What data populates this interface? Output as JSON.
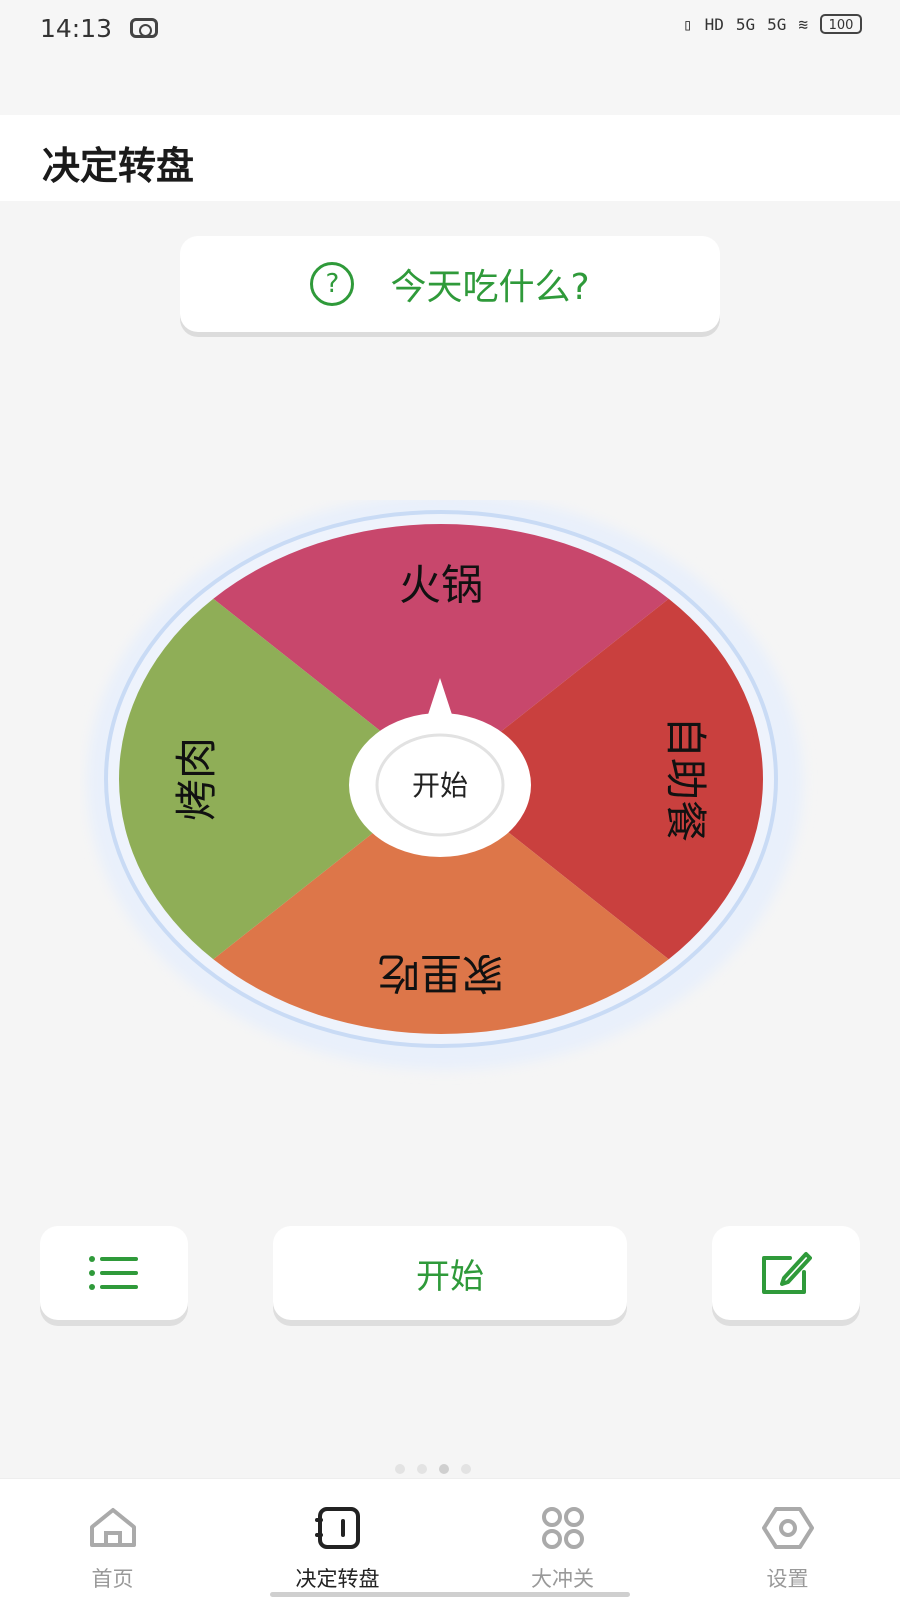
{
  "status_bar": {
    "time": "14:13",
    "icons": [
      "privacy-icon",
      "vibrate-icon",
      "hd-icon",
      "signal-5g-icon",
      "signal-5g-icon",
      "wifi-icon"
    ],
    "hd_label": "HD",
    "network_1": "5G",
    "network_2": "5G",
    "battery": "100"
  },
  "header": {
    "title": "决定转盘"
  },
  "question": {
    "text": "今天吃什么?",
    "icon": "question-circle-icon",
    "icon_glyph": "?"
  },
  "wheel": {
    "segments": [
      {
        "label": "火锅",
        "color": "#c8476c",
        "share": 0.25
      },
      {
        "label": "自助餐",
        "color": "#c9403e",
        "share": 0.25
      },
      {
        "label": "家里吃",
        "color": "#dd7649",
        "share": 0.25
      },
      {
        "label": "烤肉",
        "color": "#8fae57",
        "share": 0.25
      }
    ],
    "center_label": "开始",
    "pointer": "up"
  },
  "actions": {
    "list_icon": "list-icon",
    "start_label": "开始",
    "edit_icon": "edit-icon"
  },
  "pager": {
    "count": 4,
    "active": 3
  },
  "bottom_nav": {
    "items": [
      {
        "label": "首页",
        "icon": "home-icon"
      },
      {
        "label": "决定转盘",
        "icon": "notebook-icon",
        "active": true
      },
      {
        "label": "大冲关",
        "icon": "grid-icon"
      },
      {
        "label": "设置",
        "icon": "settings-icon"
      }
    ]
  },
  "colors": {
    "accent": "#2f9a3a",
    "active_nav": "#222222",
    "inactive_nav": "#999999"
  }
}
